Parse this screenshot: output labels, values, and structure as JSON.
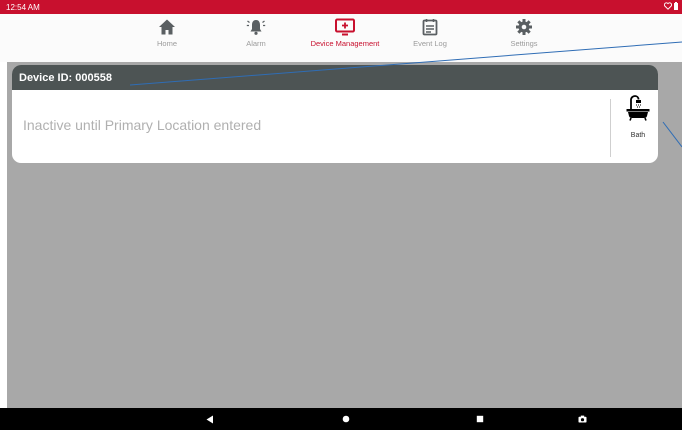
{
  "status_bar": {
    "time": "12:54 AM",
    "icons": [
      "heart-icon",
      "battery-icon"
    ]
  },
  "nav": {
    "items": [
      {
        "label": "Home",
        "icon": "home-icon",
        "active": false
      },
      {
        "label": "Alarm",
        "icon": "alarm-icon",
        "active": false
      },
      {
        "label": "Device Management",
        "icon": "device-management-icon",
        "active": true
      },
      {
        "label": "Event Log",
        "icon": "event-log-icon",
        "active": false
      },
      {
        "label": "Settings",
        "icon": "settings-icon",
        "active": false
      }
    ]
  },
  "device_card": {
    "title": "Device ID: 000558",
    "status_text": "Inactive until Primary Location entered",
    "room": {
      "label": "Bath",
      "icon": "bathtub-icon"
    }
  },
  "system_nav": {
    "buttons": [
      "back-icon",
      "home-circle-icon",
      "recents-square-icon",
      "screenshot-camera-icon"
    ]
  },
  "colors": {
    "accent": "#c8102e",
    "header": "#4d5454",
    "content_bg": "#a8a8a8",
    "inactive_nav": "#9b9b9b"
  }
}
